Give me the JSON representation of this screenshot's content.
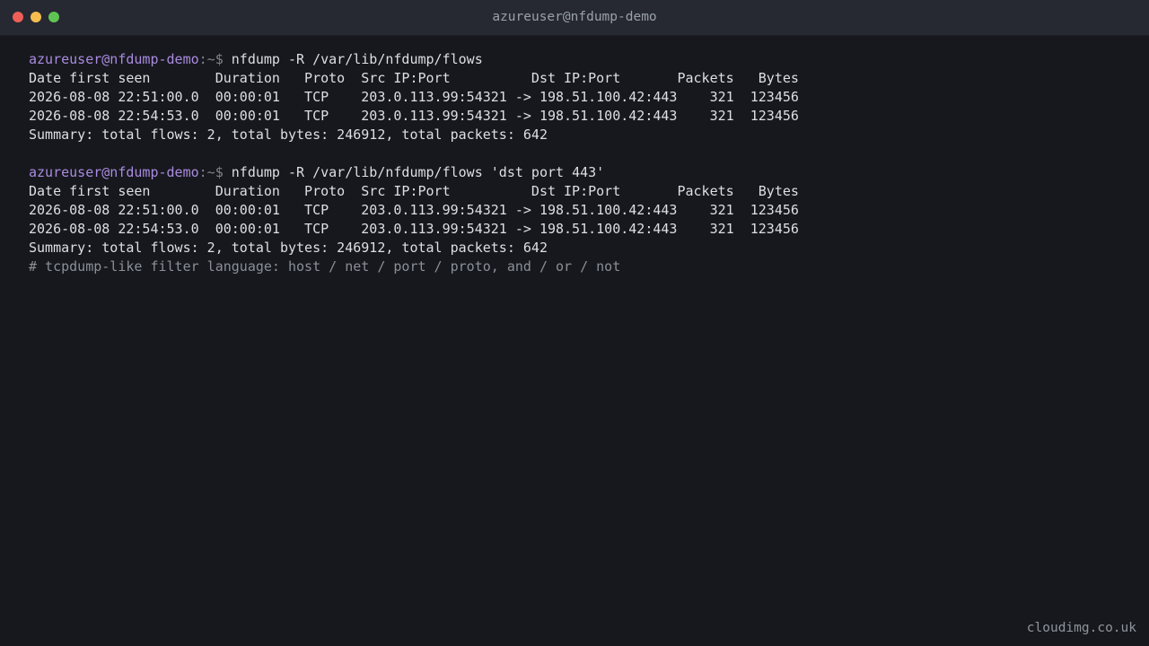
{
  "window": {
    "title": "azureuser@nfdump-demo",
    "controls": {
      "close_color": "#ee5f57",
      "minimize_color": "#f5bd4f",
      "maximize_color": "#5fc454"
    }
  },
  "prompt": {
    "user_host": "azureuser@nfdump-demo",
    "suffix": ":~$ "
  },
  "blocks": [
    {
      "command": "nfdump -R /var/lib/nfdump/flows",
      "header": "Date first seen        Duration   Proto  Src IP:Port          Dst IP:Port       Packets   Bytes",
      "rows": [
        "2026-08-08 22:51:00.0  00:00:01   TCP    203.0.113.99:54321 -> 198.51.100.42:443    321  123456",
        "2026-08-08 22:54:53.0  00:00:01   TCP    203.0.113.99:54321 -> 198.51.100.42:443    321  123456"
      ],
      "summary": "Summary: total flows: 2, total bytes: 246912, total packets: 642"
    },
    {
      "command": "nfdump -R /var/lib/nfdump/flows 'dst port 443'",
      "header": "Date first seen        Duration   Proto  Src IP:Port          Dst IP:Port       Packets   Bytes",
      "rows": [
        "2026-08-08 22:51:00.0  00:00:01   TCP    203.0.113.99:54321 -> 198.51.100.42:443    321  123456",
        "2026-08-08 22:54:53.0  00:00:01   TCP    203.0.113.99:54321 -> 198.51.100.42:443    321  123456"
      ],
      "summary": "Summary: total flows: 2, total bytes: 246912, total packets: 642"
    }
  ],
  "comment": "# tcpdump-like filter language: host / net / port / proto, and / or / not",
  "watermark": "cloudimg.co.uk",
  "colors": {
    "background": "#17181d",
    "titlebar": "#262931",
    "prompt_user": "#a98be0",
    "text": "#dcdfe4",
    "comment": "#8a8f98"
  }
}
